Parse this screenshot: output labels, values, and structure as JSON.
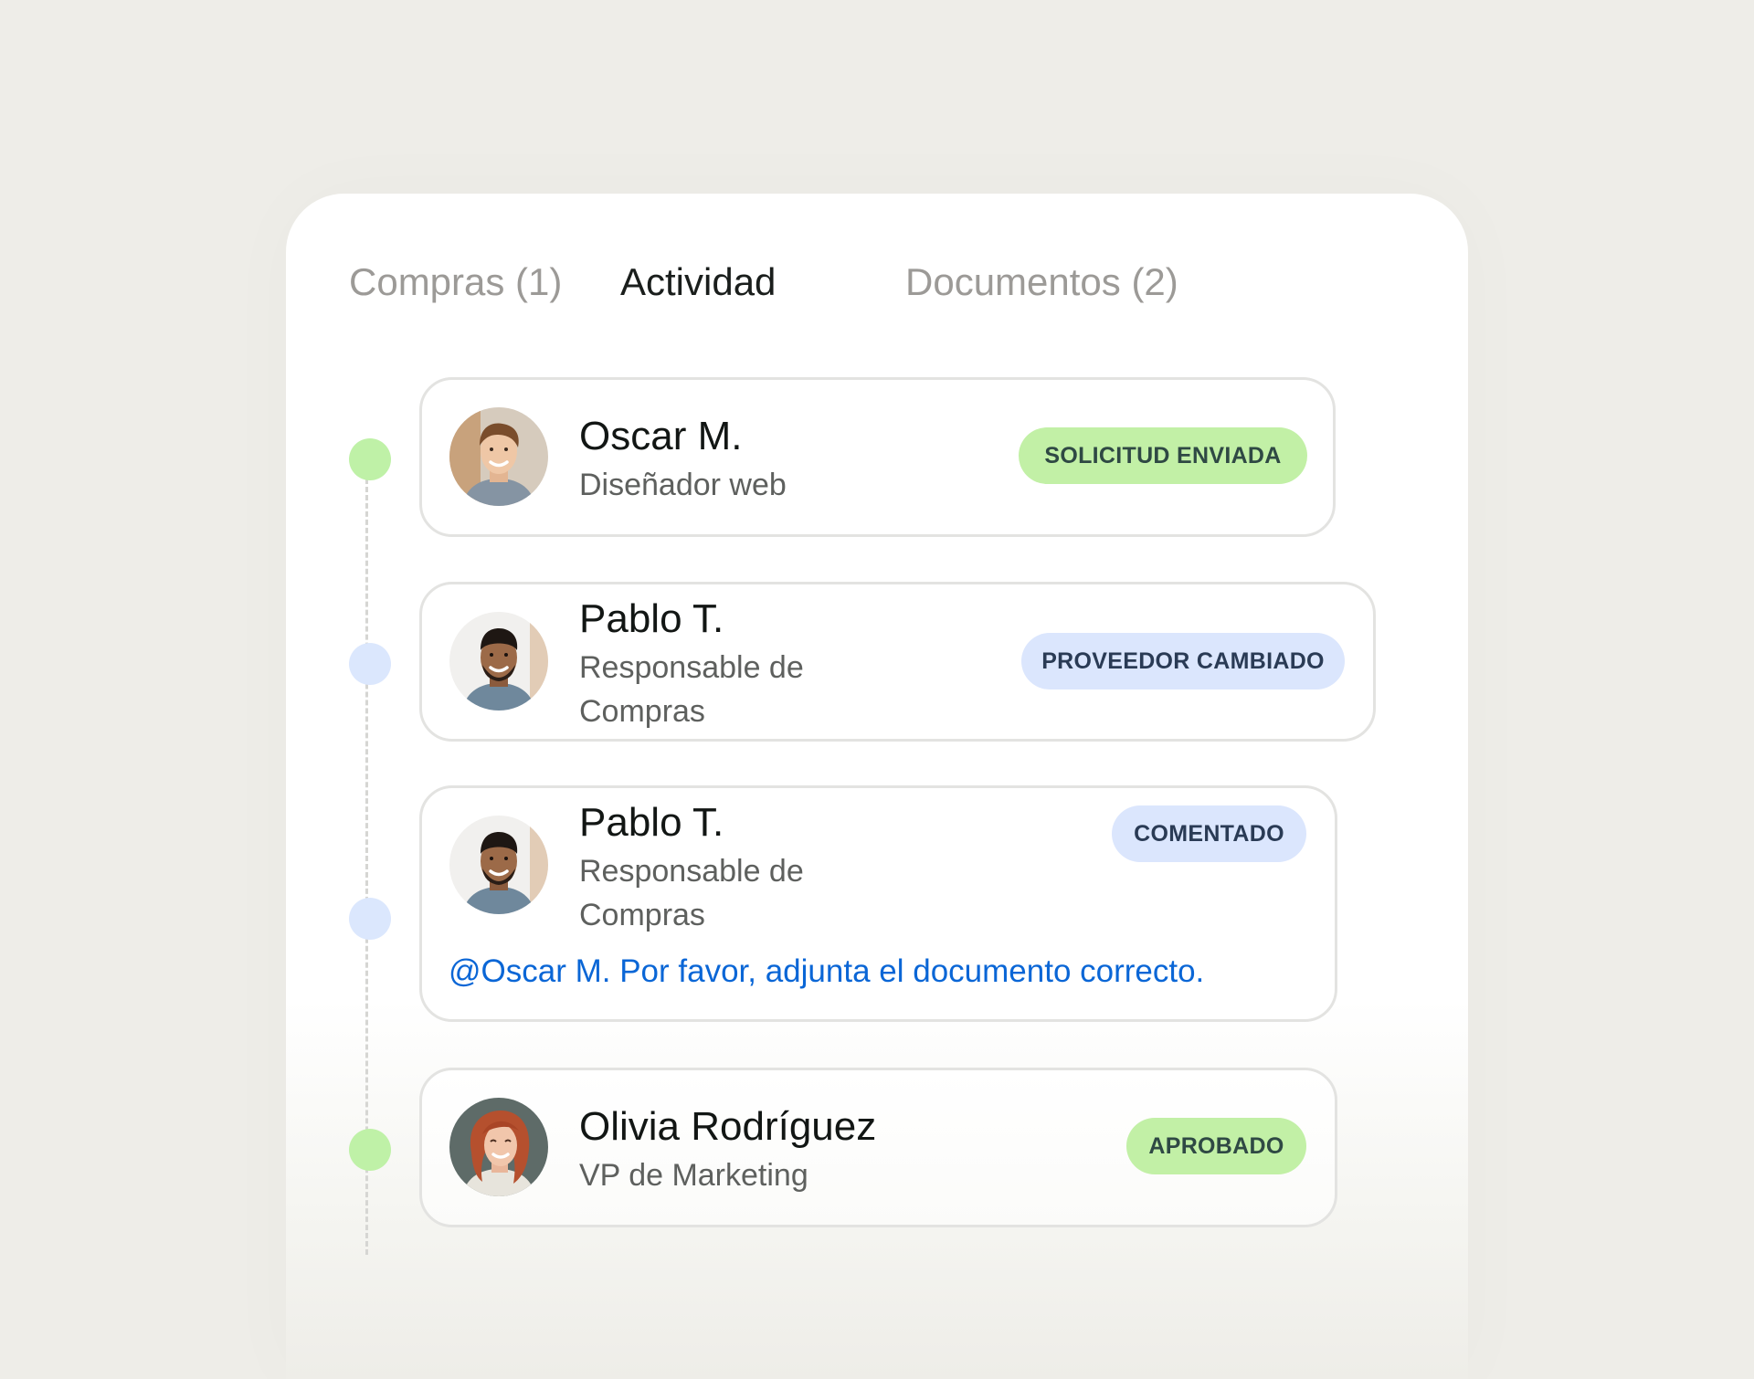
{
  "tabs": [
    {
      "label": "Compras (1)",
      "active": false
    },
    {
      "label": "Actividad",
      "active": true
    },
    {
      "label": "Documentos (2)",
      "active": false
    }
  ],
  "activities": [
    {
      "name": "Oscar M.",
      "role": "Diseñador web",
      "badge": "SOLICITUD ENVIADA",
      "status_color": "green",
      "avatar": "man-light-hair-avatar"
    },
    {
      "name": "Pablo T.",
      "role": "Responsable de Compras",
      "badge": "PROVEEDOR CAMBIADO",
      "status_color": "blue",
      "avatar": "man-dark-hair-avatar"
    },
    {
      "name": "Pablo T.",
      "role": "Responsable de Compras",
      "badge": "COMENTADO",
      "status_color": "blue",
      "avatar": "man-dark-hair-avatar",
      "comment": "@Oscar M. Por favor, adjunta el documento correcto."
    },
    {
      "name": "Olivia Rodríguez",
      "role": "VP de Marketing",
      "badge": "APROBADO",
      "status_color": "green",
      "avatar": "woman-red-hair-avatar"
    }
  ],
  "colors": {
    "background": "#eeede8",
    "panel": "#ffffff",
    "badge_green": "#c2f0a6",
    "badge_blue": "#dbe6fd",
    "dot_green": "#bff1a7",
    "dot_blue": "#dbe7fd",
    "mention_text": "#0a66d6"
  }
}
